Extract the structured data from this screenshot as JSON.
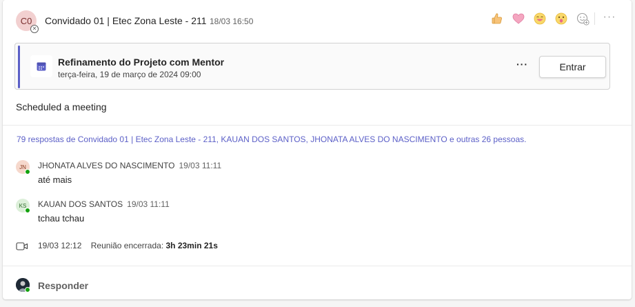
{
  "post": {
    "avatar_initials": "C0",
    "sender": "Convidado 01 | Etec Zona Leste - 211",
    "time": "18/03 16:50",
    "reactions": [
      "like-icon",
      "heart-icon",
      "laugh-icon",
      "surprised-icon",
      "add-reaction-icon"
    ],
    "more": "···"
  },
  "meeting": {
    "title": "Refinamento do Projeto com Mentor",
    "datetime": "terça-feira, 19 de março de 2024 09:00",
    "more": "···",
    "join_label": "Entrar",
    "accent_color": "#5b5fc7"
  },
  "message": "Scheduled a meeting",
  "thread": {
    "summary": "79 respostas de Convidado 01 | Etec Zona Leste - 211, KAUAN DOS SANTOS, JHONATA ALVES DO NASCIMENTO e outras 26 pessoas.",
    "replies": [
      {
        "initials": "JN",
        "name": "JHONATA ALVES DO NASCIMENTO",
        "time": "19/03 11:11",
        "text": "até mais",
        "avatar_bg": "#f6d8cc",
        "avatar_fg": "#8a3b1f"
      },
      {
        "initials": "KS",
        "name": "KAUAN DOS SANTOS",
        "time": "19/03 11:11",
        "text": "tchau tchau",
        "avatar_bg": "#dcefd9",
        "avatar_fg": "#2e6b2a"
      }
    ],
    "ended_time": "19/03 12:12",
    "ended_label": "Reunião encerrada:",
    "ended_duration": "3h 23min 21s"
  },
  "reply_label": "Responder"
}
